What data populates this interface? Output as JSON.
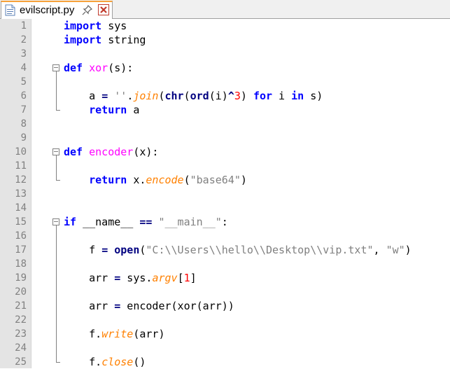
{
  "tab": {
    "filename": "evilscript.py",
    "icons": [
      "python-file-icon",
      "pin-icon",
      "close-icon"
    ],
    "close_color": "#c0392b"
  },
  "editor": {
    "line_numbers": [
      "1",
      "2",
      "3",
      "4",
      "5",
      "6",
      "7",
      "8",
      "9",
      "10",
      "11",
      "12",
      "13",
      "14",
      "15",
      "16",
      "17",
      "18",
      "19",
      "20",
      "21",
      "22",
      "23",
      "24",
      "25"
    ],
    "lines": [
      "import sys",
      "import string",
      "",
      "def xor(s):",
      "",
      "    a = ''.join(chr(ord(i)^3) for i in s)",
      "    return a",
      "",
      "",
      "def encoder(x):",
      "",
      "    return x.encode(\"base64\")",
      "",
      "",
      "if __name__ == \"__main__\":",
      "",
      "    f = open(\"C:\\\\Users\\\\hello\\\\Desktop\\\\vip.txt\", \"w\")",
      "",
      "    arr = sys.argv[1]",
      "",
      "    arr = encoder(xor(arr))",
      "",
      "    f.write(arr)",
      "",
      "    f.close()"
    ]
  },
  "colors": {
    "keyword": "#0000ff",
    "function_name": "#ff00ff",
    "operator": "#000080",
    "string": "#808080",
    "number": "#ff0000",
    "method": "#ff8000",
    "gutter_bg": "#e4e4e4"
  }
}
